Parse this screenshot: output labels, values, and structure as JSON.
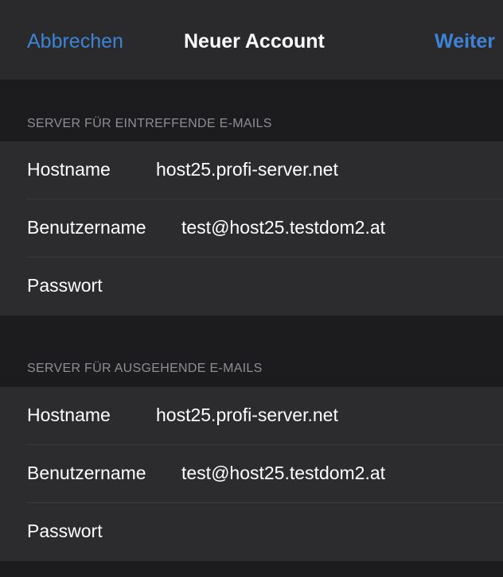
{
  "navbar": {
    "cancel_label": "Abbrechen",
    "title": "Neuer Account",
    "next_label": "Weiter"
  },
  "incoming": {
    "header": "SERVER FÜR EINTREFFENDE E-MAILS",
    "rows": [
      {
        "label": "Hostname",
        "value": "host25.profi-server.net"
      },
      {
        "label": "Benutzername",
        "value": "test@host25.testdom2.at"
      },
      {
        "label": "Passwort",
        "value": ""
      }
    ]
  },
  "outgoing": {
    "header": "SERVER FÜR AUSGEHENDE E-MAILS",
    "rows": [
      {
        "label": "Hostname",
        "value": "host25.profi-server.net"
      },
      {
        "label": "Benutzername",
        "value": "test@host25.testdom2.at"
      },
      {
        "label": "Passwort",
        "value": ""
      }
    ]
  },
  "colors": {
    "accent": "#3d84d6",
    "background": "#1c1c1e",
    "cell": "#2c2c2e",
    "secondary_text": "#8e8e93"
  }
}
